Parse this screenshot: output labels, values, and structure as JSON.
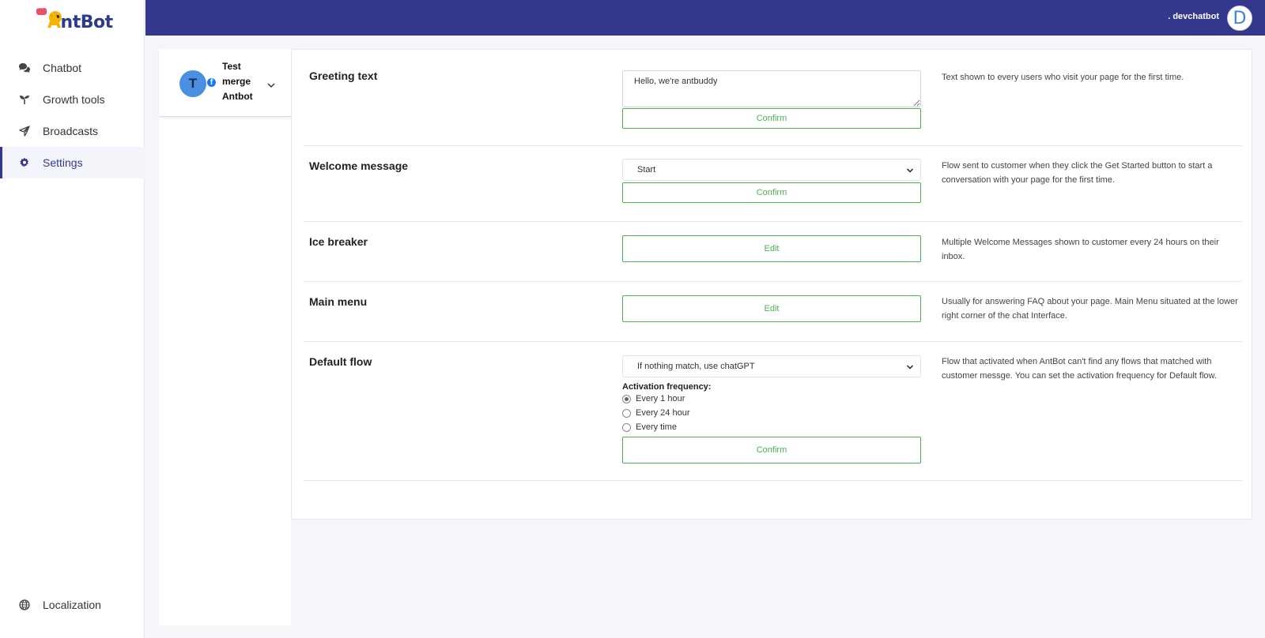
{
  "brand": {
    "logo_text_a": "A",
    "logo_text_rest": "ntBot",
    "full": "AntBot"
  },
  "sidebar": {
    "items": [
      {
        "label": "Chatbot",
        "icon": "chat-bubbles-icon"
      },
      {
        "label": "Growth tools",
        "icon": "sprout-icon"
      },
      {
        "label": "Broadcasts",
        "icon": "paper-plane-icon"
      },
      {
        "label": "Settings",
        "icon": "gear-icon",
        "active": true
      }
    ],
    "bottom": {
      "label": "Localization",
      "icon": "globe-icon"
    }
  },
  "header": {
    "user_name": ". devchatbot",
    "avatar_letter": "D"
  },
  "page_selector": {
    "avatar_letter": "T",
    "name": "Test merge Antbot",
    "platform_icon": "facebook-icon"
  },
  "settings": {
    "greeting": {
      "title": "Greeting text",
      "value": "Hello, we're antbuddy",
      "button": "Confirm",
      "description": "Text shown to every users who visit your page for the first time."
    },
    "welcome": {
      "title": "Welcome message",
      "selected": "Start",
      "button": "Confirm",
      "description": "Flow sent to customer when they click the Get Started button to start a conversation with your page for the first time."
    },
    "ice_breaker": {
      "title": "Ice breaker",
      "button": "Edit",
      "description": "Multiple Welcome Messages shown to customer every 24 hours on their inbox."
    },
    "main_menu": {
      "title": "Main menu",
      "button": "Edit",
      "description": "Usually for answering FAQ about your page. Main Menu situated at the lower right corner of the chat Interface."
    },
    "default_flow": {
      "title": "Default flow",
      "selected": "If nothing match, use chatGPT",
      "frequency_label": "Activation frequency:",
      "options": [
        "Every 1 hour",
        "Every 24 hour",
        "Every time"
      ],
      "selected_option": "Every 1 hour",
      "button": "Confirm",
      "description": "Flow that activated when AntBot can't find any flows that matched with customer messge. You can set the activation frequency for Default flow."
    }
  },
  "colors": {
    "header": "#34388d",
    "accent_green": "#4caf50",
    "logo_yellow": "#f4b400"
  }
}
